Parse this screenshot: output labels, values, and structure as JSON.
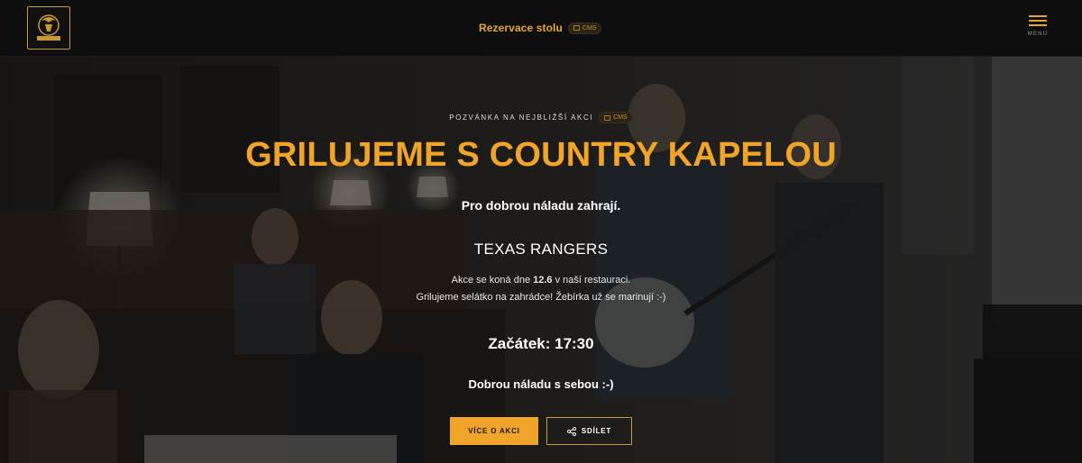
{
  "header": {
    "logo_name": "logo",
    "nav_link": "Rezervace stolu",
    "cms_badge": "CMS",
    "menu_label": "MENU"
  },
  "hero": {
    "eyebrow": "POZVÁNKA NA NEJBLIŽŠÍ AKCI",
    "eyebrow_badge": "CMS",
    "title": "GRILUJEME S COUNTRY KAPELOU",
    "lead": "Pro dobrou náladu zahrají.",
    "band": "TEXAS RANGERS",
    "info_prefix": "Akce se koná dne ",
    "info_date": "12.6",
    "info_suffix": " v naší restauraci.",
    "info_line2": "Grilujeme selátko na zahrádce! Žebírka už se marinují :-)",
    "start": "Začátek: 17:30",
    "closing": "Dobrou náladu s sebou :-)",
    "btn_more": "VÍCE O AKCI",
    "btn_share": "SDÍLET"
  },
  "colors": {
    "accent": "#f0a52a",
    "header_bg": "#0e0e0e"
  }
}
